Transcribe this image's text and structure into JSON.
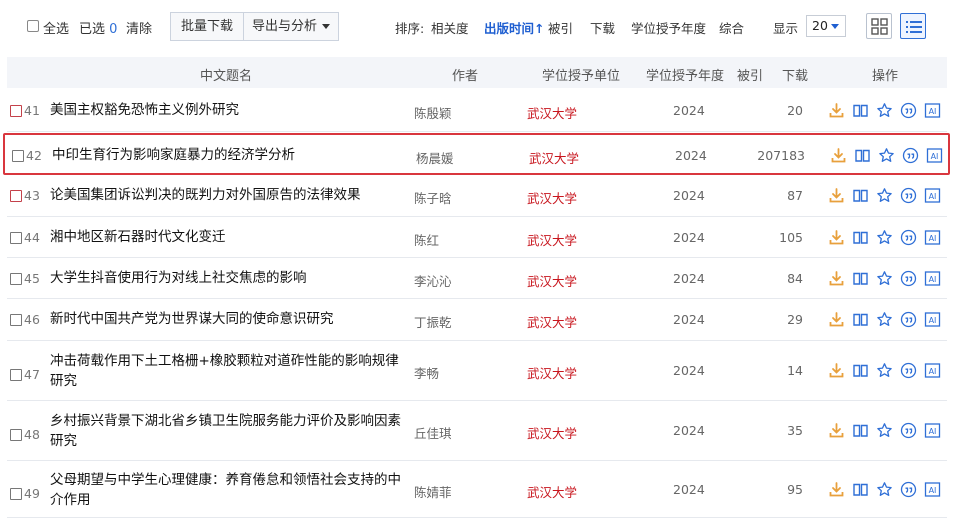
{
  "toolbar": {
    "select_all": "全选",
    "selected_label": "已选",
    "selected_count": "0",
    "clear": "清除",
    "batch_download": "批量下载",
    "export_analysis": "导出与分析",
    "sort_label": "排序:",
    "sort_options": [
      "相关度",
      "出版时间",
      "被引",
      "下载",
      "学位授予年度",
      "综合"
    ],
    "sort_active_arrow": "↑",
    "display_label": "显示",
    "page_size": "20"
  },
  "table": {
    "headers": [
      "中文题名",
      "作者",
      "学位授予单位",
      "学位授予年度",
      "被引",
      "下载",
      "操作"
    ],
    "rows": [
      {
        "num": "41",
        "title": "美国主权豁免恐怖主义例外研究",
        "author": "陈殷颖",
        "unit": "武汉大学",
        "year": "2024",
        "downloads": "20"
      },
      {
        "num": "42",
        "title": "中印生育行为影响家庭暴力的经济学分析",
        "author": "杨晨媛",
        "unit": "武汉大学",
        "year": "2024",
        "downloads": "207183"
      },
      {
        "num": "43",
        "title": "论美国集团诉讼判决的既判力对外国原告的法律效果",
        "author": "陈子晗",
        "unit": "武汉大学",
        "year": "2024",
        "downloads": "87"
      },
      {
        "num": "44",
        "title": "湘中地区新石器时代文化变迁",
        "author": "陈红",
        "unit": "武汉大学",
        "year": "2024",
        "downloads": "105"
      },
      {
        "num": "45",
        "title": "大学生抖音使用行为对线上社交焦虑的影响",
        "author": "李沁沁",
        "unit": "武汉大学",
        "year": "2024",
        "downloads": "84"
      },
      {
        "num": "46",
        "title": "新时代中国共产党为世界谋大同的使命意识研究",
        "author": "丁振乾",
        "unit": "武汉大学",
        "year": "2024",
        "downloads": "29"
      },
      {
        "num": "47",
        "title": "冲击荷载作用下土工格栅+橡胶颗粒对道砟性能的影响规律研究",
        "author": "李畅",
        "unit": "武汉大学",
        "year": "2024",
        "downloads": "14"
      },
      {
        "num": "48",
        "title": "乡村振兴背景下湖北省乡镇卫生院服务能力评价及影响因素研究",
        "author": "丘佳琪",
        "unit": "武汉大学",
        "year": "2024",
        "downloads": "35"
      },
      {
        "num": "49",
        "title": "父母期望与中学生心理健康：养育倦怠和领悟社会支持的中介作用",
        "author": "陈婧菲",
        "unit": "武汉大学",
        "year": "2024",
        "downloads": "95"
      }
    ]
  },
  "icons": [
    "download-icon",
    "read-icon",
    "favorite-icon",
    "quote-icon",
    "ai-icon"
  ],
  "colors": {
    "accent": "#1f5fd1",
    "unit_red": "#c8161e",
    "highlight": "#d9363e",
    "icon_orange": "#e8a03c",
    "icon_blue": "#2f6fd6"
  }
}
